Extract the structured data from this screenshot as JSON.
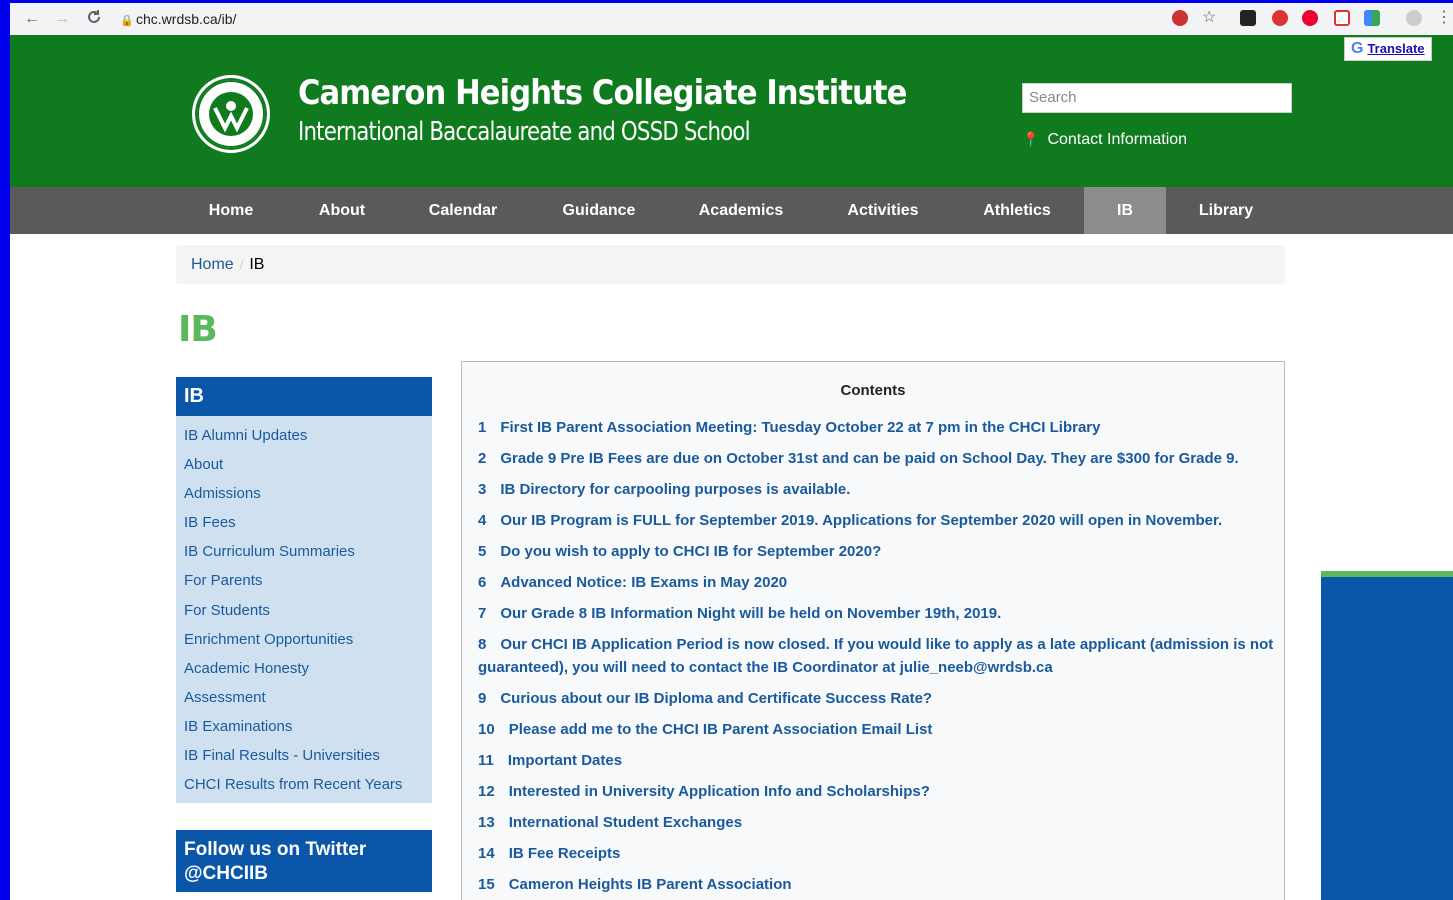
{
  "browser": {
    "url": "chc.wrdsb.ca/ib/",
    "back_icon": "←",
    "forward_icon": "→",
    "reload_icon": "C"
  },
  "header": {
    "title": "Cameron Heights Collegiate Institute",
    "subtitle": "International Baccalaureate and OSSD School",
    "search_placeholder": "Search",
    "contact": "Contact Information",
    "translate": "Translate",
    "brand_color": "#0f7a1e"
  },
  "nav": {
    "items": [
      "Home",
      "About",
      "Calendar",
      "Guidance",
      "Academics",
      "Activities",
      "Athletics",
      "IB",
      "Library"
    ],
    "active": "IB"
  },
  "breadcrumb": {
    "home": "Home",
    "current": "IB"
  },
  "page_title": "IB",
  "sidebar": {
    "heading": "IB",
    "links": [
      "IB Alumni Updates",
      "About",
      "Admissions",
      "IB Fees",
      "IB Curriculum Summaries",
      "For Parents",
      "For Students",
      "Enrichment Opportunities",
      "Academic Honesty",
      "Assessment",
      "IB Examinations",
      "IB Final Results - Universities",
      "CHCI Results from Recent Years"
    ],
    "twitter": "Follow us on Twitter @CHCIIB"
  },
  "contents": {
    "title": "Contents",
    "entries": [
      {
        "num": "1",
        "text": "First IB Parent Association Meeting:  Tuesday October 22 at 7 pm in the CHCI Library"
      },
      {
        "num": "2",
        "text": "Grade 9 Pre IB Fees are due on October 31st and can be paid on School Day. They are $300 for Grade 9."
      },
      {
        "num": "3",
        "text": "IB Directory for carpooling purposes is available."
      },
      {
        "num": "4",
        "text": "Our IB Program is FULL for September 2019.  Applications for September 2020 will open in November."
      },
      {
        "num": "5",
        "text": "Do you wish to apply to CHCI IB for September 2020?"
      },
      {
        "num": "6",
        "text": "Advanced Notice: IB Exams in May 2020"
      },
      {
        "num": "7",
        "text": "Our Grade 8 IB Information Night will be held on November 19th, 2019."
      },
      {
        "num": "8",
        "text": "Our CHCI IB Application Period is now closed.  If you would like to apply as a late applicant (admission is not guaranteed), you will need to contact the IB Coordinator at julie_neeb@wrdsb.ca"
      },
      {
        "num": "9",
        "text": "Curious about our IB Diploma and Certificate Success Rate?"
      },
      {
        "num": "10",
        "text": "Please add me to the CHCI IB Parent Association Email List"
      },
      {
        "num": "11",
        "text": "Important Dates"
      },
      {
        "num": "12",
        "text": "Interested in University Application Info and Scholarships?"
      },
      {
        "num": "13",
        "text": "International Student Exchanges"
      },
      {
        "num": "14",
        "text": "IB Fee Receipts"
      },
      {
        "num": "15",
        "text": "Cameron Heights IB Parent Association"
      }
    ]
  }
}
